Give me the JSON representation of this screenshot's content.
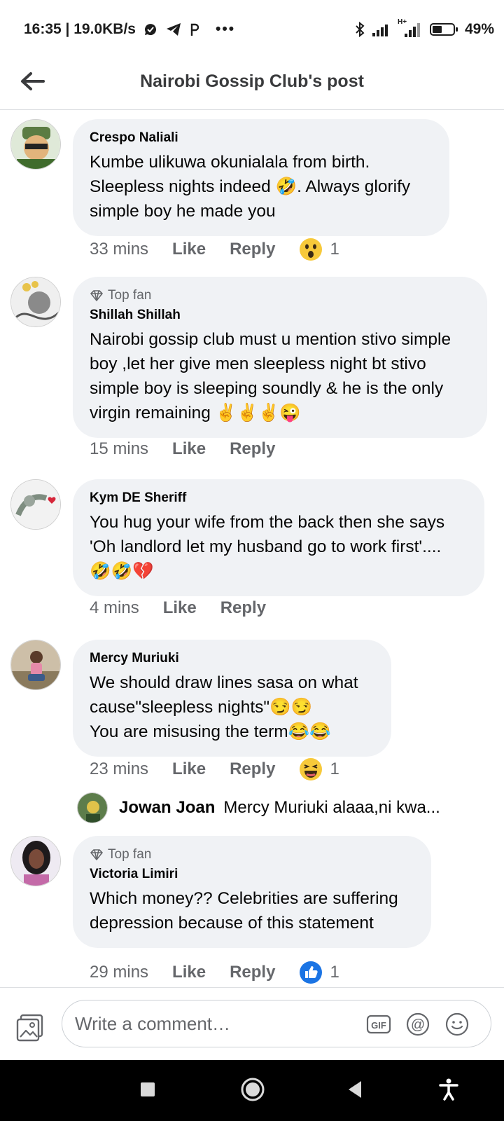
{
  "status_bar": {
    "time_speed": "16:35 | 19.0KB/s",
    "more": "•••",
    "network_type": "H+",
    "battery": "49%",
    "battery_level": 0.49
  },
  "header": {
    "title": "Nairobi Gossip Club's post"
  },
  "actions": {
    "like": "Like",
    "reply": "Reply"
  },
  "comments": [
    {
      "author": "Crespo Naliali",
      "badge": "",
      "text": "Kumbe ulikuwa okunialala from birth. Sleepless nights indeed 🤣. Always glorify simple boy he made you",
      "time": "33 mins",
      "reaction_icon": "wow-icon",
      "reaction_count": "1"
    },
    {
      "author": "Shillah Shillah",
      "badge": "Top fan",
      "text": "Nairobi gossip club must u mention stivo simple boy ,let her give men sleepless night bt stivo simple boy is sleeping soundly & he is the only virgin remaining ✌️✌️✌️😜",
      "time": "15 mins",
      "reaction_icon": "",
      "reaction_count": ""
    },
    {
      "author": "Kym DE Sheriff",
      "badge": "",
      "text": "You hug your wife from the back then she says 'Oh landlord let my husband go to work first'....\n🤣🤣💔",
      "time": "4 mins",
      "reaction_icon": "",
      "reaction_count": ""
    },
    {
      "author": "Mercy Muriuki",
      "badge": "",
      "text": "We should draw lines sasa on what cause\"sleepless nights\"😏😏\nYou are misusing the term😂😂",
      "time": "23 mins",
      "reaction_icon": "haha-icon",
      "reaction_count": "1",
      "reply_preview": {
        "author": "Jowan Joan",
        "text": "Mercy Muriuki alaaa,ni kwa..."
      }
    },
    {
      "author": "Victoria Limiri",
      "badge": "Top fan",
      "text": "Which money?? Celebrities are suffering depression because of this statement",
      "time": "29 mins",
      "reaction_icon": "like-icon",
      "reaction_count": "1"
    }
  ],
  "composer": {
    "placeholder": "Write a comment…",
    "gif": "GIF",
    "at": "@"
  }
}
